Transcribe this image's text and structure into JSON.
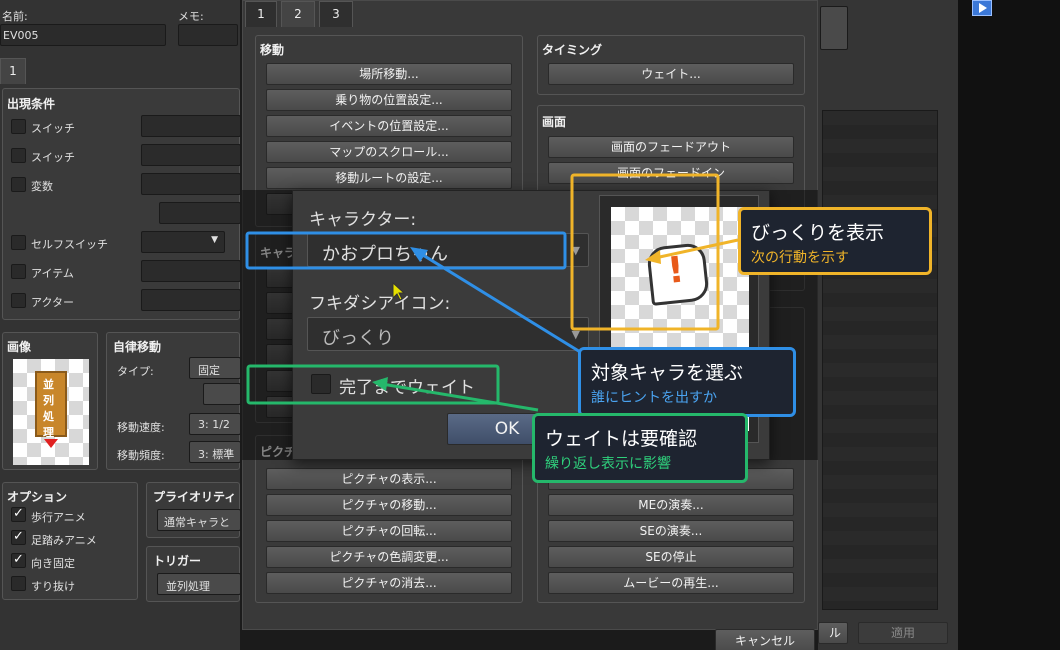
{
  "left": {
    "name_label": "名前:",
    "name_value": "EV005",
    "memo_label": "メモ:",
    "page_tab": "1",
    "conditions_title": "出現条件",
    "conditions": [
      "スイッチ",
      "スイッチ",
      "変数",
      "セルフスイッチ",
      "アイテム",
      "アクター"
    ],
    "image_title": "画像",
    "image_banner": "並列処理",
    "autonomous_title": "自律移動",
    "type_label": "タイプ:",
    "type_value": "固定",
    "speed_label": "移動速度:",
    "speed_value": "3: 1/2",
    "freq_label": "移動頻度:",
    "freq_value": "3: 標準",
    "options_title": "オプション",
    "options": [
      {
        "label": "歩行アニメ",
        "checked": true
      },
      {
        "label": "足踏みアニメ",
        "checked": true
      },
      {
        "label": "向き固定",
        "checked": true
      },
      {
        "label": "すり抜け",
        "checked": false
      }
    ],
    "priority_title": "プライオリティ",
    "priority_value": "通常キャラと",
    "trigger_title": "トリガー",
    "trigger_value": "並列処理"
  },
  "command_window": {
    "tabs": [
      "1",
      "2",
      "3"
    ],
    "move_title": "移動",
    "move_buttons": [
      "場所移動...",
      "乗り物の位置設定...",
      "イベントの位置設定...",
      "マップのスクロール...",
      "移動ルートの設定..."
    ],
    "timing_title": "タイミング",
    "timing_buttons": [
      "ウェイト..."
    ],
    "screen_title": "画面",
    "screen_buttons": [
      "画面のフェードアウト",
      "画面のフェードイン"
    ],
    "character_partial": "キャラ",
    "picture_title": "ピクチ",
    "picture_buttons": [
      "ピクチャの表示...",
      "ピクチャの移動...",
      "ピクチャの回転...",
      "ピクチャの色調変更...",
      "ピクチャの消去..."
    ],
    "audio_buttons": [
      "MEの演奏...",
      "SEの演奏...",
      "SEの停止",
      "ムービーの再生..."
    ]
  },
  "dialog": {
    "character_label": "キャラクター:",
    "character_value": "かおプロちゃん",
    "balloon_label": "フキダシアイコン:",
    "balloon_value": "びっくり",
    "wait_label": "完了までウェイト",
    "wait_checked": false,
    "ok_label": "OK"
  },
  "callouts": {
    "balloon_main": "びっくりを表示",
    "balloon_sub": "次の行動を示す",
    "target_main": "対象キャラを選ぶ",
    "target_sub": "誰にヒントを出すか",
    "wait_main": "ウェイトは要確認",
    "wait_sub": "繰り返し表示に影響"
  },
  "bottom": {
    "cancel_label": "キャンセル",
    "apply_label": "適用",
    "partial_label": "ル"
  },
  "colors": {
    "orange": "#f0b429",
    "blue": "#2f8fe6",
    "green": "#25b86b"
  }
}
